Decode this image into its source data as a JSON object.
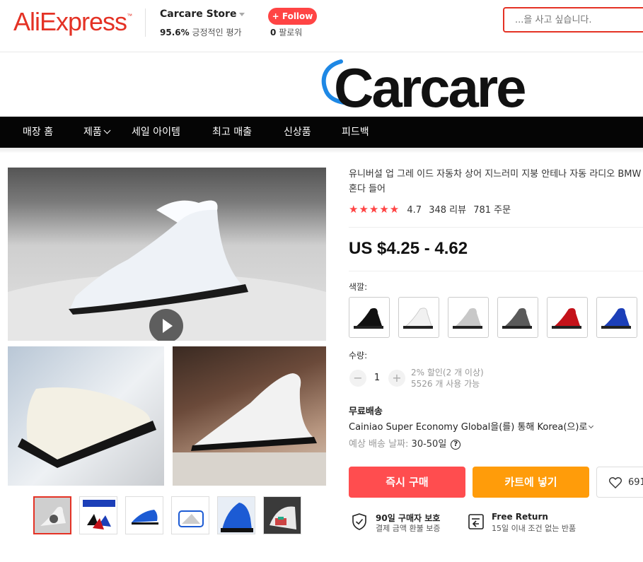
{
  "header": {
    "logo": "AliExpress",
    "logo_tm": "™",
    "store_name": "Carcare Store",
    "store_rating_value": "95.6%",
    "store_rating_label": "긍정적인 평가",
    "follow_label": "+ Follow",
    "followers_count": "0",
    "followers_label": "팔로워",
    "search_placeholder": "...을 사고 싶습니다."
  },
  "banner": {
    "brand": "Carcare"
  },
  "nav": {
    "items": [
      "매장 홈",
      "제품",
      "세일 아이템",
      "최고 매출",
      "신상품",
      "피드백"
    ]
  },
  "product": {
    "title": "유니버설 업 그레 이드 자동차 상어 지느러미 지붕 안테나 자동 라디오 BMW 혼다 들어",
    "stars": "★★★★★",
    "rating": "4.7",
    "reviews": "348 리뷰",
    "orders": "781 주문",
    "price": "US $4.25 - 4.62",
    "color_label": "색깔:",
    "swatches": [
      {
        "name": "black",
        "color": "#111111"
      },
      {
        "name": "white",
        "color": "#f4f4f4"
      },
      {
        "name": "silver",
        "color": "#c8c8c8"
      },
      {
        "name": "gray",
        "color": "#5a5a5a"
      },
      {
        "name": "red",
        "color": "#c4121a"
      },
      {
        "name": "blue",
        "color": "#1c3fb8"
      }
    ],
    "quantity_label": "수량:",
    "quantity": "1",
    "qty_minus": "−",
    "qty_plus": "+",
    "discount": "2% 할인(2 개 이상)",
    "available": "5526 개 사용 가능",
    "shipping_title": "무료배송",
    "shipping_method": "Cainiao Super Economy Global을(를) 통해 Korea(으)로",
    "eta_label": "예상 배송 날짜:",
    "eta_value": "30-50일",
    "help_glyph": "?",
    "buy_now": "즉시 구매",
    "add_to_cart": "카트에 넣기",
    "wishlist_count": "691"
  },
  "protection": {
    "buyer_title": "90일 구매자 보호",
    "buyer_desc": "결제 금액 환불 보증",
    "return_title": "Free Return",
    "return_desc": "15일 이내 조건 없는 반품"
  },
  "colors": {
    "accent": "#e43225",
    "buy": "#ff4d4f",
    "cart": "#ff9c0a"
  }
}
